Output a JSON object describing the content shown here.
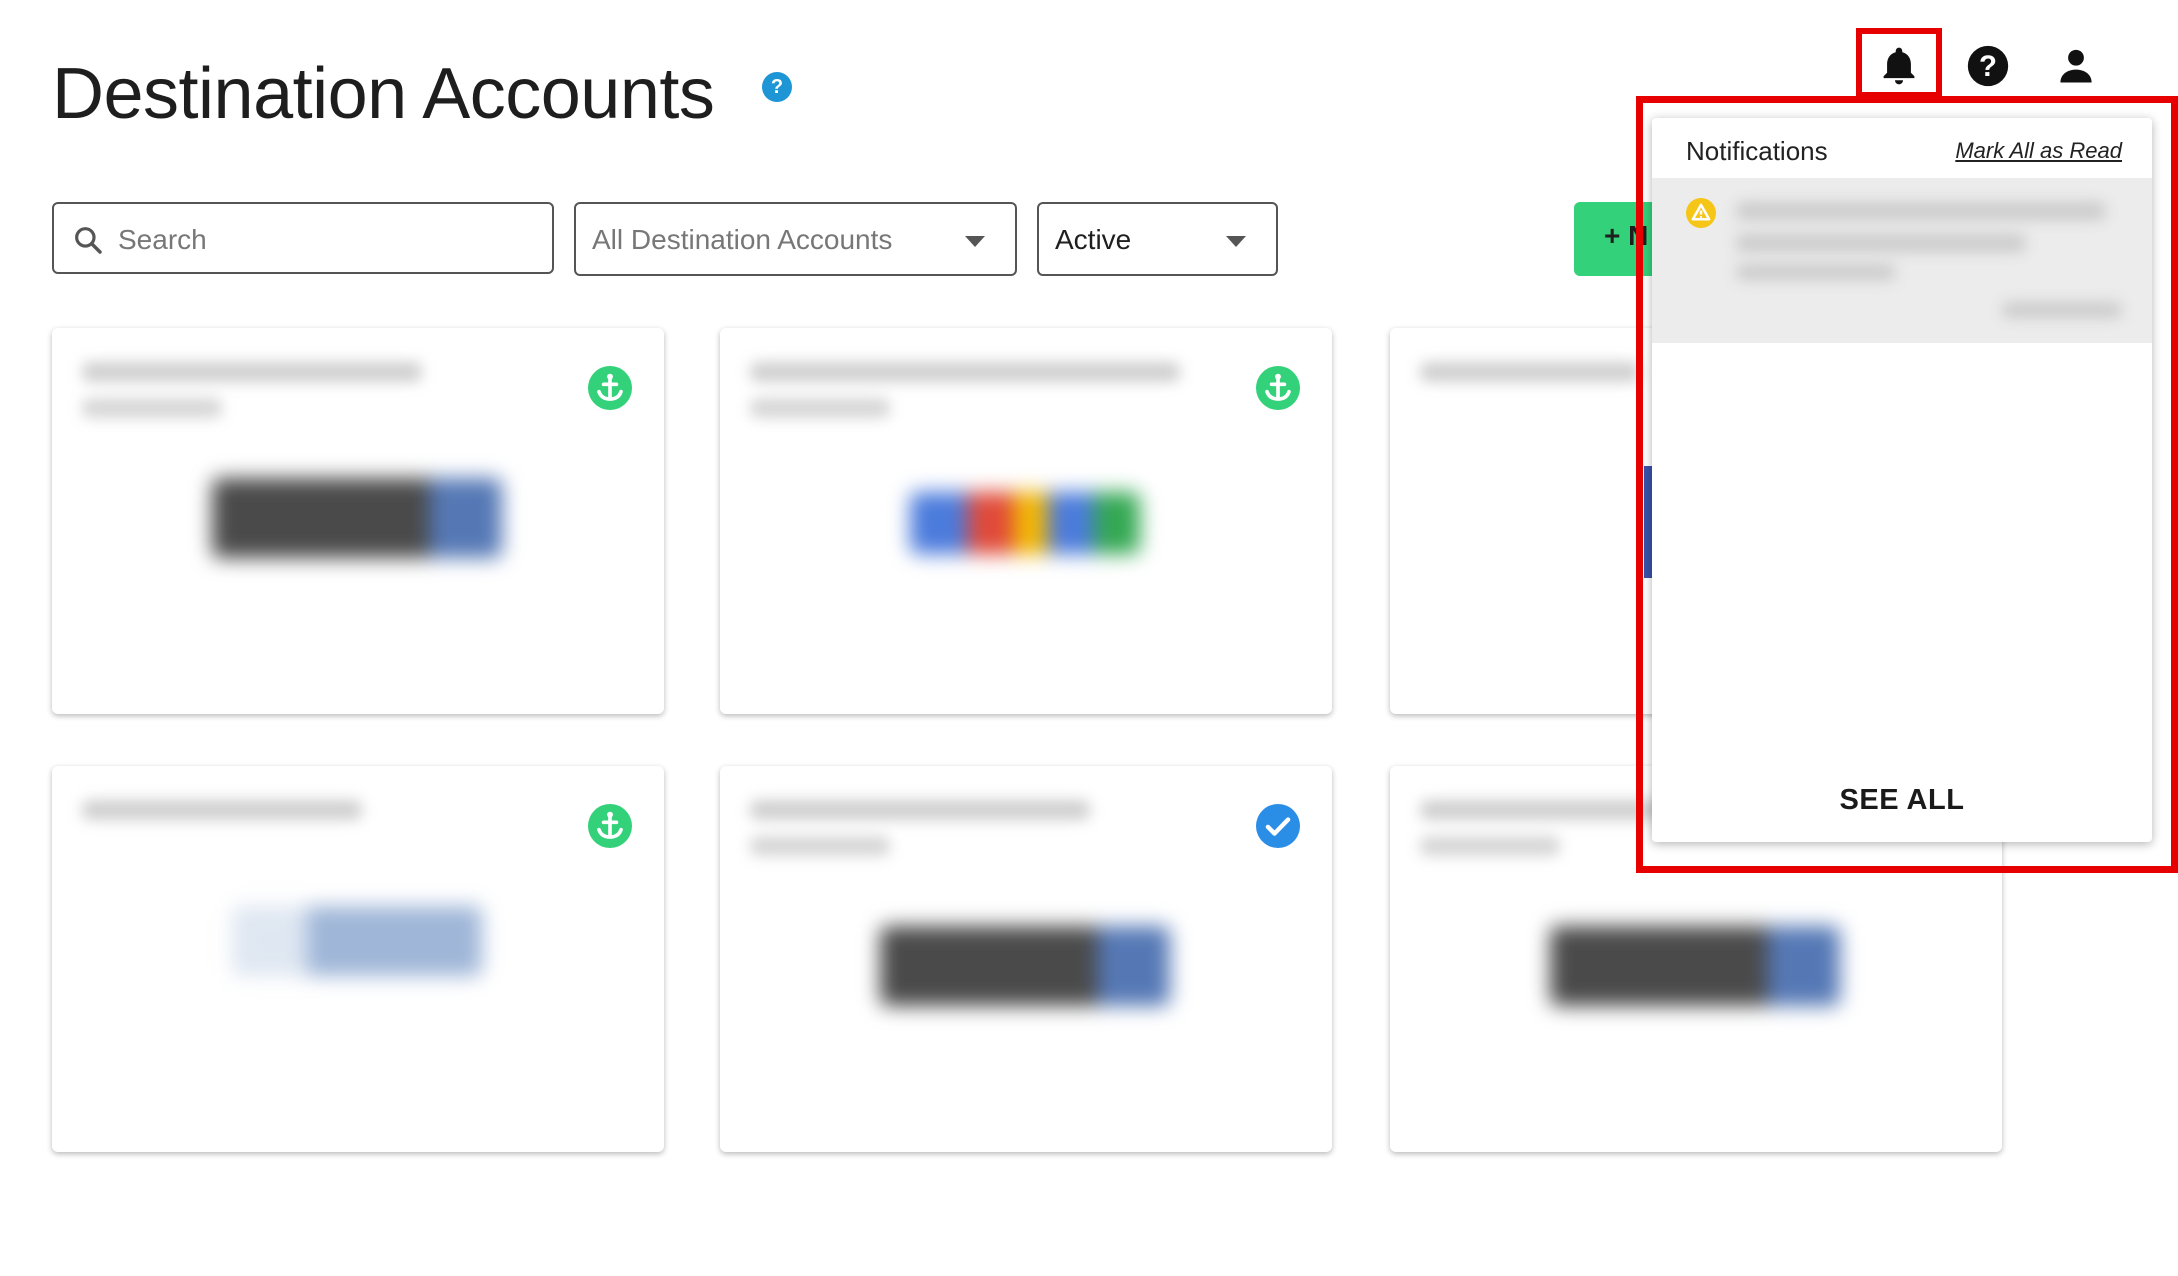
{
  "header": {
    "title": "Destination Accounts",
    "help_badge": "?",
    "icons": [
      "bell-icon",
      "help-icon",
      "user-icon"
    ]
  },
  "filters": {
    "search_placeholder": "Search",
    "account_select": "All Destination Accounts",
    "status_select": "Active"
  },
  "new_button": {
    "label": "+ N"
  },
  "cards": [
    {
      "status": "anchor-icon",
      "status_color": "#33d17a"
    },
    {
      "status": "anchor-icon",
      "status_color": "#33d17a"
    },
    {
      "status": "none"
    },
    {
      "status": "anchor-icon",
      "status_color": "#33d17a"
    },
    {
      "status": "check-icon",
      "status_color": "#2a8de6"
    },
    {
      "status": "none"
    }
  ],
  "notifications": {
    "title": "Notifications",
    "mark_all_label": "Mark All as Read",
    "see_all_label": "SEE ALL",
    "item_icon": "warning-icon"
  },
  "colors": {
    "accent_green": "#33d17a",
    "highlight_red": "#e60000",
    "info_blue": "#1e96d6",
    "warning_yellow": "#f5c518"
  }
}
